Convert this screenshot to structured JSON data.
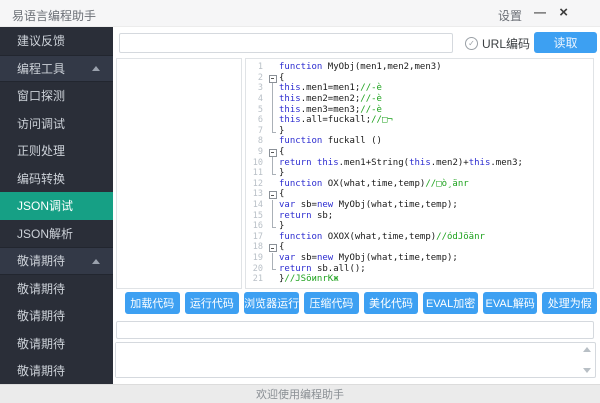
{
  "titlebar": {
    "title": "易语言编程助手",
    "settings": "设置",
    "minimize": "—",
    "close": "×"
  },
  "sidebar": {
    "items": [
      {
        "key": "feedback",
        "label": "建议反馈",
        "type": "item"
      },
      {
        "key": "tools-group",
        "label": "编程工具",
        "type": "group"
      },
      {
        "key": "window-detect",
        "label": "窗口探测",
        "type": "item"
      },
      {
        "key": "access-debug",
        "label": "访问调试",
        "type": "item"
      },
      {
        "key": "regex-process",
        "label": "正则处理",
        "type": "item"
      },
      {
        "key": "encode-convert",
        "label": "编码转换",
        "type": "item"
      },
      {
        "key": "json-debug",
        "label": "JSON调试",
        "type": "item",
        "selected": true
      },
      {
        "key": "json-parse",
        "label": "JSON解析",
        "type": "item"
      },
      {
        "key": "coming-group",
        "label": "敬请期待",
        "type": "group"
      },
      {
        "key": "coming-1",
        "label": "敬请期待",
        "type": "item"
      },
      {
        "key": "coming-2",
        "label": "敬请期待",
        "type": "item"
      },
      {
        "key": "coming-3",
        "label": "敬请期待",
        "type": "item"
      },
      {
        "key": "coming-4",
        "label": "敬请期待",
        "type": "item"
      }
    ]
  },
  "toolbar": {
    "url_input_value": "",
    "url_encode_label": "URL编码",
    "check_glyph": "✓",
    "read_button": "读取"
  },
  "editor": {
    "lines": [
      {
        "n": 1,
        "g": "",
        "s": [
          [
            "function ",
            "k"
          ],
          [
            "MyObj(men1,men2,men3)",
            "p"
          ]
        ]
      },
      {
        "n": 2,
        "g": "open",
        "s": [
          [
            "{",
            "p"
          ]
        ]
      },
      {
        "n": 3,
        "g": "mid",
        "s": [
          [
            "this",
            "k"
          ],
          [
            ".men1=men1;",
            "p"
          ],
          [
            "//-è",
            "c"
          ]
        ]
      },
      {
        "n": 4,
        "g": "mid",
        "s": [
          [
            "this",
            "k"
          ],
          [
            ".men2=men2;",
            "p"
          ],
          [
            "//-è",
            "c"
          ]
        ]
      },
      {
        "n": 5,
        "g": "mid",
        "s": [
          [
            "this",
            "k"
          ],
          [
            ".men3=men3;",
            "p"
          ],
          [
            "//-è",
            "c"
          ]
        ]
      },
      {
        "n": 6,
        "g": "mid",
        "s": [
          [
            "this",
            "k"
          ],
          [
            ".all=fuckall;",
            "p"
          ],
          [
            "//□¬",
            "c"
          ]
        ]
      },
      {
        "n": 7,
        "g": "end",
        "s": [
          [
            "}",
            "p"
          ]
        ]
      },
      {
        "n": 8,
        "g": "",
        "s": [
          [
            "function ",
            "k"
          ],
          [
            "fuckall ()",
            "p"
          ]
        ]
      },
      {
        "n": 9,
        "g": "open",
        "s": [
          [
            "{",
            "p"
          ]
        ]
      },
      {
        "n": 10,
        "g": "mid",
        "s": [
          [
            "return ",
            "k"
          ],
          [
            "this",
            "k"
          ],
          [
            ".men1+String(",
            "p"
          ],
          [
            "this",
            "k"
          ],
          [
            ".men2)+",
            "p"
          ],
          [
            "this",
            "k"
          ],
          [
            ".men3;",
            "p"
          ]
        ]
      },
      {
        "n": 11,
        "g": "end",
        "s": [
          [
            "}",
            "p"
          ]
        ]
      },
      {
        "n": 12,
        "g": "",
        "s": [
          [
            "function ",
            "k"
          ],
          [
            "OX(what,time,temp)",
            "p"
          ],
          [
            "//□ò¸änr",
            "c"
          ]
        ]
      },
      {
        "n": 13,
        "g": "open",
        "s": [
          [
            "{",
            "p"
          ]
        ]
      },
      {
        "n": 14,
        "g": "mid",
        "s": [
          [
            "var ",
            "k"
          ],
          [
            "sb=",
            "p"
          ],
          [
            "new ",
            "k"
          ],
          [
            "MyObj(what,time,temp);",
            "p"
          ]
        ]
      },
      {
        "n": 15,
        "g": "mid",
        "s": [
          [
            "return ",
            "k"
          ],
          [
            "sb;",
            "p"
          ]
        ]
      },
      {
        "n": 16,
        "g": "end",
        "s": [
          [
            "}",
            "p"
          ]
        ]
      },
      {
        "n": 17,
        "g": "",
        "s": [
          [
            "function ",
            "k"
          ],
          [
            "OXOX(what,time,temp)",
            "p"
          ],
          [
            "//ódJöänr",
            "c"
          ]
        ]
      },
      {
        "n": 18,
        "g": "open",
        "s": [
          [
            "{",
            "p"
          ]
        ]
      },
      {
        "n": 19,
        "g": "mid",
        "s": [
          [
            "var ",
            "k"
          ],
          [
            "sb=",
            "p"
          ],
          [
            "new ",
            "k"
          ],
          [
            "MyObj(what,time,temp);",
            "p"
          ]
        ]
      },
      {
        "n": 20,
        "g": "end",
        "s": [
          [
            "return ",
            "k"
          ],
          [
            "sb.all();",
            "p"
          ]
        ]
      },
      {
        "n": 21,
        "g": "",
        "s": [
          [
            "}",
            "p"
          ],
          [
            "//JSöиnrКж",
            "c"
          ]
        ]
      }
    ]
  },
  "actions": [
    {
      "key": "load-code",
      "label": "加载代码"
    },
    {
      "key": "run-code",
      "label": "运行代码"
    },
    {
      "key": "browser-run",
      "label": "浏览器运行"
    },
    {
      "key": "compress-code",
      "label": "压缩代码"
    },
    {
      "key": "beautify-code",
      "label": "美化代码"
    },
    {
      "key": "eval-encrypt",
      "label": "EVAL加密"
    },
    {
      "key": "eval-decode",
      "label": "EVAL解码"
    },
    {
      "key": "process-fake",
      "label": "处理为假"
    }
  ],
  "bottom": {
    "input_value": "",
    "textarea_value": ""
  },
  "statusbar": {
    "text": "欢迎使用编程助手"
  },
  "colors": {
    "accent_blue": "#3da0f2",
    "sidebar_bg": "#2a2e38",
    "selected_teal": "#16a085",
    "keyword": "#2d2dd0",
    "comment": "#1ea21e"
  }
}
